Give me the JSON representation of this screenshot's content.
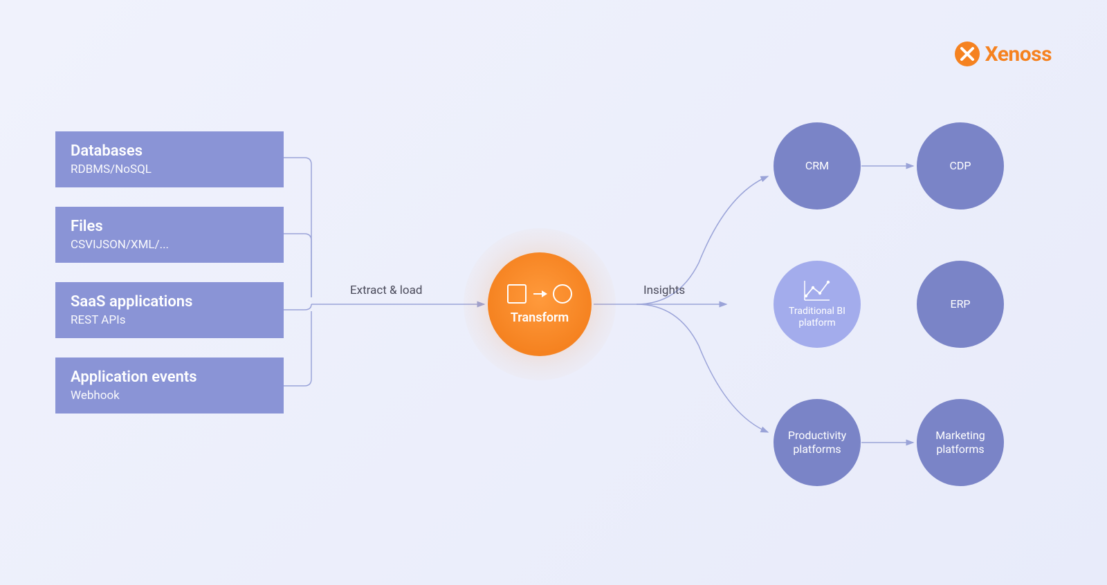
{
  "logo": {
    "text": "Xenoss"
  },
  "sources": [
    {
      "title": "Databases",
      "sub": "RDBMS/NoSQL"
    },
    {
      "title": "Files",
      "sub": "CSVIJSON/XML/..."
    },
    {
      "title": "SaaS applications",
      "sub": "REST APIs"
    },
    {
      "title": "Application events",
      "sub": "Webhook"
    }
  ],
  "edges": {
    "extract_load": "Extract & load",
    "insights": "Insights"
  },
  "center": {
    "label": "Transform"
  },
  "destinations": {
    "crm": "CRM",
    "cdp": "CDP",
    "bi": "Traditional BI platform",
    "erp": "ERP",
    "productivity": "Productivity platforms",
    "marketing": "Marketing platforms"
  },
  "colors": {
    "accent_orange": "#f58220",
    "box_purple": "#8a94d6",
    "circle_purple": "#7a84c7",
    "light_purple": "#a3acec",
    "stroke": "#9aa3d8"
  }
}
